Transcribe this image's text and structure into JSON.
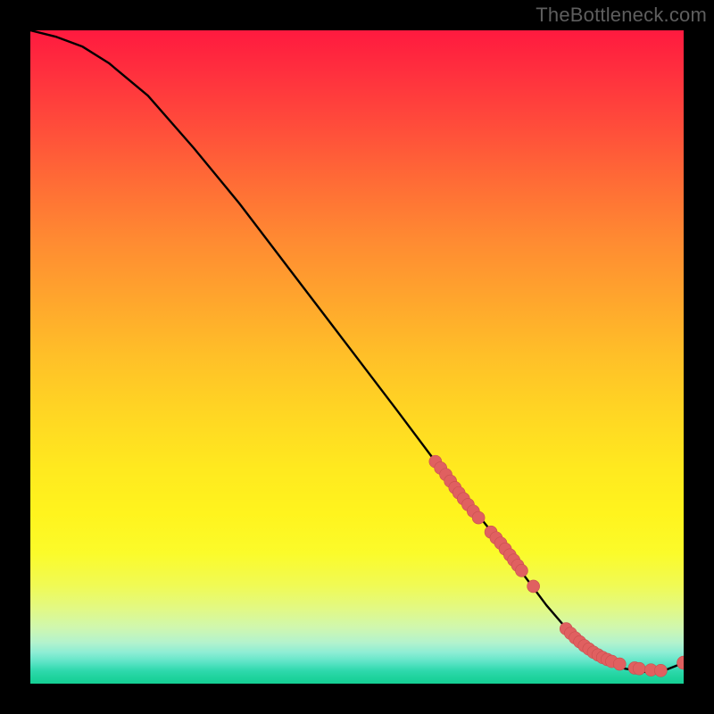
{
  "watermark": "TheBottleneck.com",
  "chart_data": {
    "type": "line",
    "title": "",
    "xlabel": "",
    "ylabel": "",
    "xlim": [
      0,
      100
    ],
    "ylim": [
      0,
      100
    ],
    "curve": {
      "x": [
        0,
        4,
        8,
        12,
        18,
        25,
        32,
        40,
        48,
        56,
        62,
        66,
        70,
        73,
        76,
        79,
        82,
        85,
        88,
        91,
        94,
        97,
        100
      ],
      "y": [
        100,
        99,
        97.5,
        95,
        90,
        82,
        73.5,
        63,
        52.5,
        42,
        34,
        29,
        24,
        20,
        16,
        12,
        8.5,
        5.5,
        3.5,
        2.3,
        1.8,
        2.0,
        3.2
      ]
    },
    "marker_points": {
      "x": [
        62.0,
        62.8,
        63.6,
        64.3,
        65.0,
        65.6,
        66.3,
        67.0,
        67.8,
        68.6,
        70.5,
        71.3,
        72.0,
        72.7,
        73.4,
        74.0,
        74.6,
        75.2,
        77.0,
        82.0,
        82.7,
        83.4,
        84.1,
        84.8,
        85.5,
        86.2,
        86.9,
        87.6,
        88.3,
        89.0,
        90.2,
        92.5,
        93.2,
        95.0,
        96.5,
        100.0
      ],
      "y": [
        34.0,
        33.0,
        32.0,
        31.0,
        30.0,
        29.2,
        28.3,
        27.4,
        26.4,
        25.4,
        23.2,
        22.3,
        21.5,
        20.6,
        19.7,
        18.9,
        18.1,
        17.3,
        14.9,
        8.4,
        7.7,
        7.0,
        6.4,
        5.8,
        5.3,
        4.8,
        4.4,
        4.0,
        3.7,
        3.4,
        3.0,
        2.4,
        2.3,
        2.1,
        2.0,
        3.2
      ]
    },
    "gradient_background": true
  }
}
